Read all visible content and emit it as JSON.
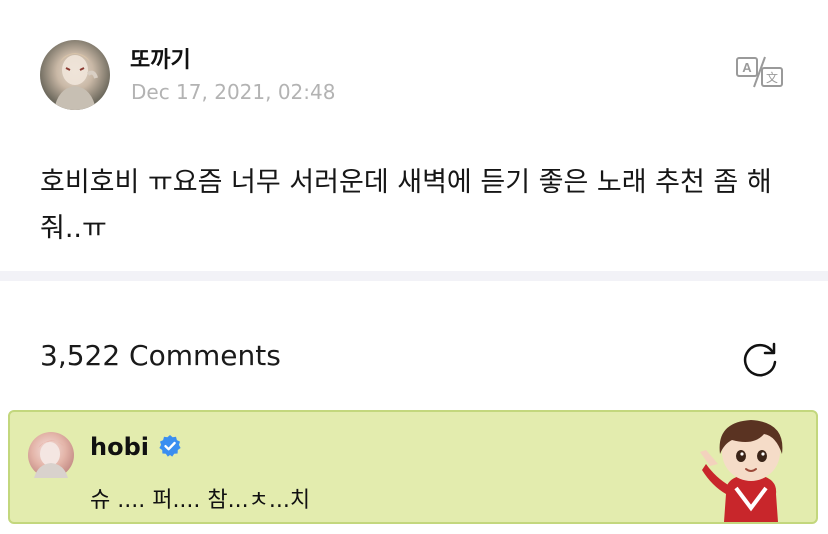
{
  "post": {
    "author": "또까기",
    "date": "Dec 17, 2021, 02:48",
    "body": "호비호비 ㅠ요즘 너무 서러운데 새벽에 듣기 좋은 노래 추천 좀 해줘..ㅠ",
    "translate_icon": "translate-icon"
  },
  "comments": {
    "count_label": "3,522 Comments",
    "refresh_icon": "refresh-icon",
    "highlighted": {
      "author": "hobi",
      "verified": true,
      "text": "슈 .... 퍼.... 참...ㅊ...치",
      "background": "#e3ecae",
      "border": "#c3d77d"
    }
  },
  "colors": {
    "date": "#b3b3b3",
    "divider": "#f2f2f7",
    "verified_badge": "#3a8ef0"
  }
}
